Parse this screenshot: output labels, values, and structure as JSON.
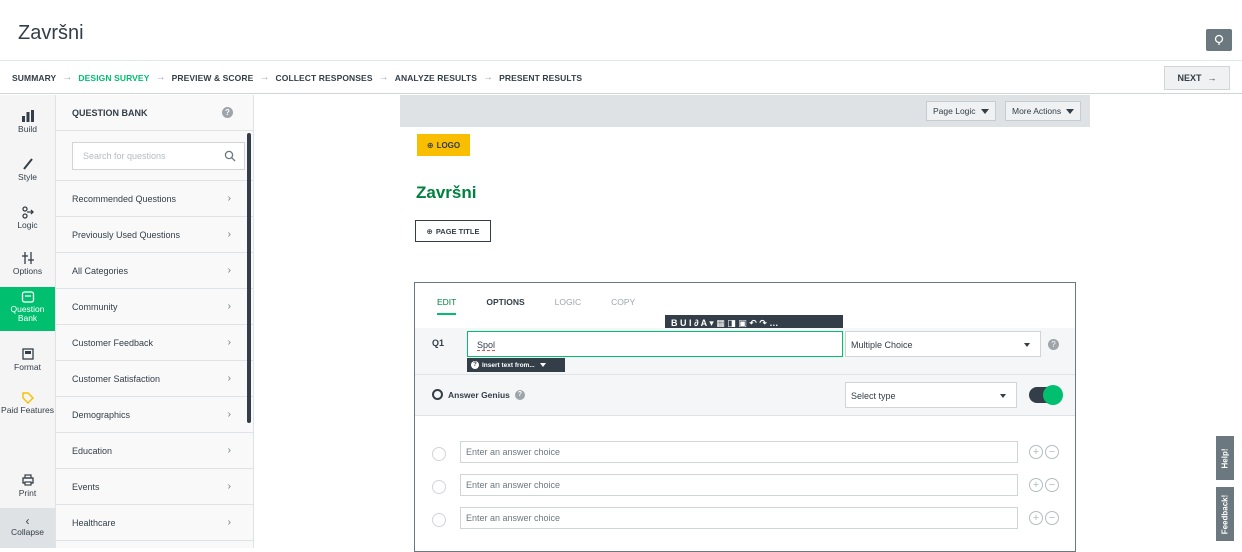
{
  "header": {
    "survey_title": "Završni"
  },
  "nav": {
    "steps": [
      "SUMMARY",
      "DESIGN SURVEY",
      "PREVIEW & SCORE",
      "COLLECT RESPONSES",
      "ANALYZE RESULTS",
      "PRESENT RESULTS"
    ],
    "active_step": "DESIGN SURVEY",
    "next_label": "NEXT"
  },
  "rail": {
    "items": [
      {
        "label": "Build",
        "icon": "build-icon"
      },
      {
        "label": "Style",
        "icon": "brush-icon"
      },
      {
        "label": "Logic",
        "icon": "logic-icon"
      },
      {
        "label": "Options",
        "icon": "options-icon"
      },
      {
        "label": "Question Bank",
        "icon": "question-bank-icon"
      },
      {
        "label": "Format",
        "icon": "format-icon"
      },
      {
        "label": "Paid Features",
        "icon": "tag-icon"
      },
      {
        "label": "Print",
        "icon": "print-icon"
      }
    ],
    "active": "Question Bank",
    "collapse_label": "Collapse"
  },
  "question_bank": {
    "title": "QUESTION BANK",
    "search_placeholder": "Search for questions",
    "categories": [
      "Recommended Questions",
      "Previously Used Questions",
      "All Categories",
      "Community",
      "Customer Feedback",
      "Customer Satisfaction",
      "Demographics",
      "Education",
      "Events",
      "Healthcare"
    ]
  },
  "toolbar": {
    "page_logic": "Page Logic",
    "more_actions": "More Actions"
  },
  "page": {
    "logo_label": "LOGO",
    "title": "Završni",
    "page_title_label": "PAGE TITLE"
  },
  "question": {
    "tabs": [
      "EDIT",
      "OPTIONS",
      "LOGIC",
      "COPY"
    ],
    "active_tab": "EDIT",
    "rte_tools": "B U I ∂ A ▾ ▦ ◨ ▣ ↶ ↷ …",
    "number": "Q1",
    "text": "Spol",
    "type": "Multiple Choice",
    "insert_tip": "Insert text from...",
    "answer_genius_label": "Answer Genius",
    "answer_genius_select": "Select type",
    "answer_genius_on": true,
    "answer_placeholder": "Enter an answer choice",
    "answer_count": 3
  },
  "side_tabs": {
    "help": "Help!",
    "feedback": "Feedback!"
  },
  "colors": {
    "accent": "#00bf6f",
    "title_green": "#00813f",
    "logo_yellow": "#f9be00",
    "dark": "#333e48"
  }
}
